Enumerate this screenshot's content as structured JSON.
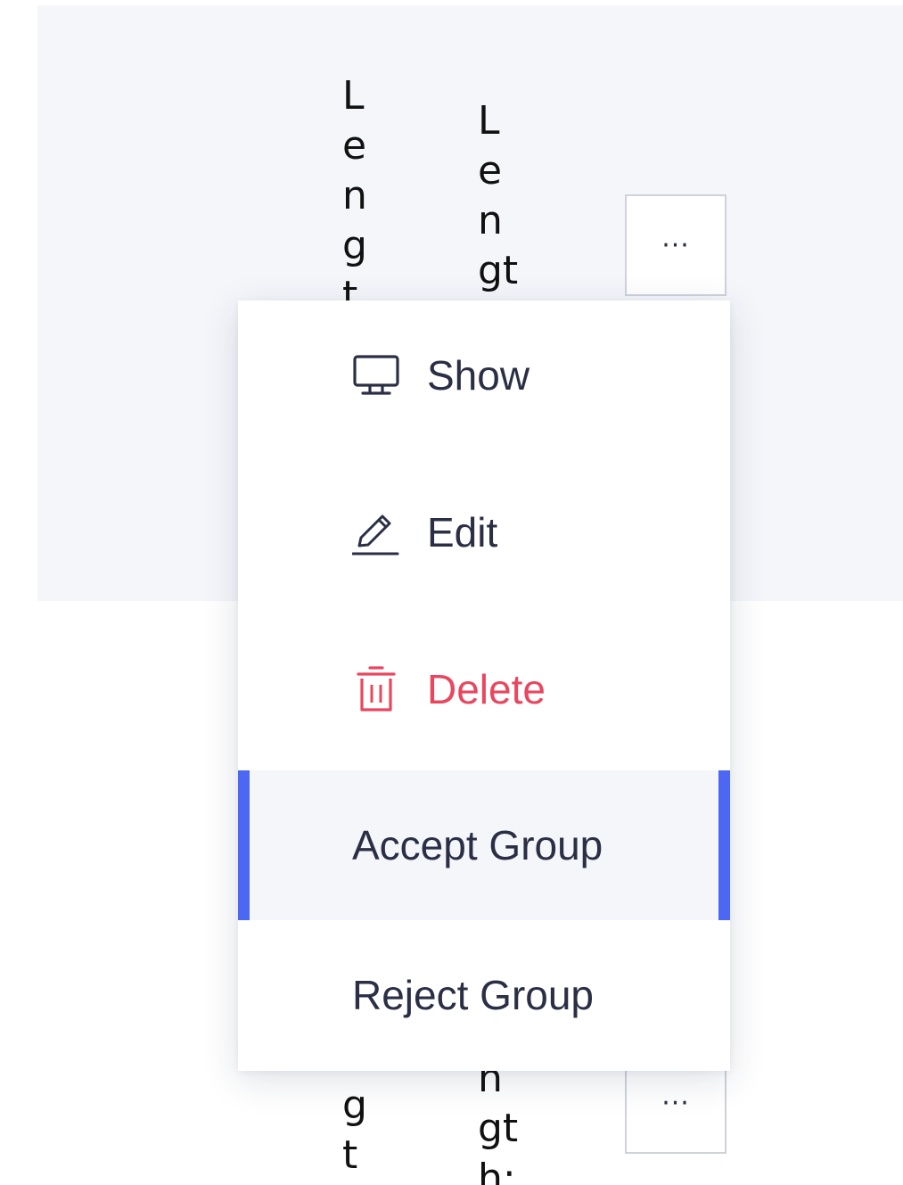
{
  "table": {
    "col1_top_text": "L\ne\nn\ng\nt",
    "col2_top_text": "L\ne\nn\ngt",
    "col1_bottom_text": "g\nt",
    "col2_bottom_text": "n\ngt\nh:",
    "more_label": "···"
  },
  "menu": {
    "show": "Show",
    "edit": "Edit",
    "delete": "Delete",
    "accept": "Accept Group",
    "reject": "Reject Group"
  },
  "colors": {
    "accent": "#4c68f2",
    "danger": "#e8475f",
    "text": "#2b2f45",
    "row_bg": "#f5f6fa"
  },
  "icons": {
    "show": "monitor-icon",
    "edit": "pencil-icon",
    "delete": "trash-icon"
  }
}
